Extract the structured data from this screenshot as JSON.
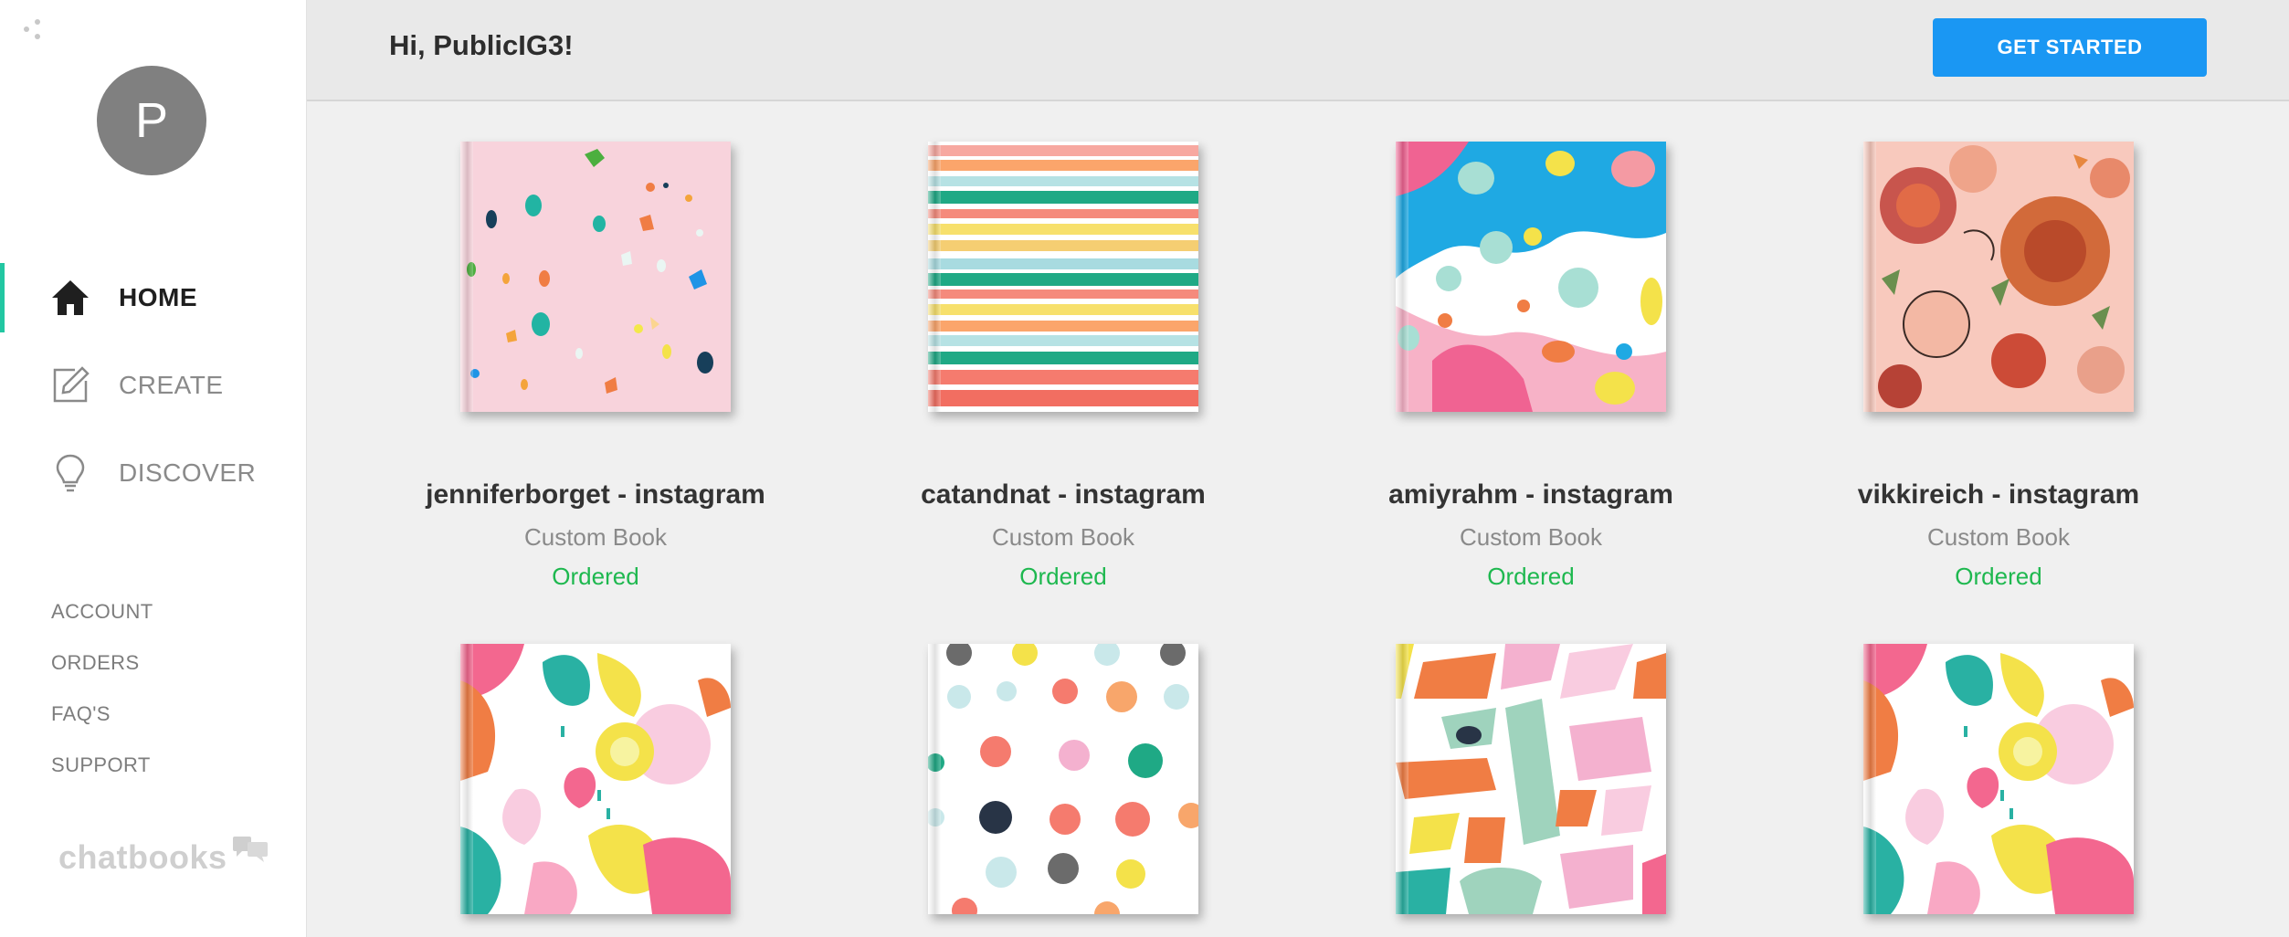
{
  "user": {
    "avatar_initial": "P"
  },
  "nav": {
    "home": "HOME",
    "create": "CREATE",
    "discover": "DISCOVER"
  },
  "links": {
    "account": "ACCOUNT",
    "orders": "ORDERS",
    "faqs": "FAQ'S",
    "support": "SUPPORT"
  },
  "brand": {
    "name": "chatbooks"
  },
  "header": {
    "greeting": "Hi, PublicIG3!",
    "cta_label": "GET STARTED"
  },
  "books": [
    {
      "title": "jenniferborget - instagram",
      "subtitle": "Custom Book",
      "status": "Ordered"
    },
    {
      "title": "catandnat - instagram",
      "subtitle": "Custom Book",
      "status": "Ordered"
    },
    {
      "title": "amiyrahm - instagram",
      "subtitle": "Custom Book",
      "status": "Ordered"
    },
    {
      "title": "vikkireich - instagram",
      "subtitle": "Custom Book",
      "status": "Ordered"
    }
  ],
  "colors": {
    "accent": "#1a97f3",
    "active_indicator": "#22c7a2",
    "status_ordered": "#1eb84f"
  }
}
